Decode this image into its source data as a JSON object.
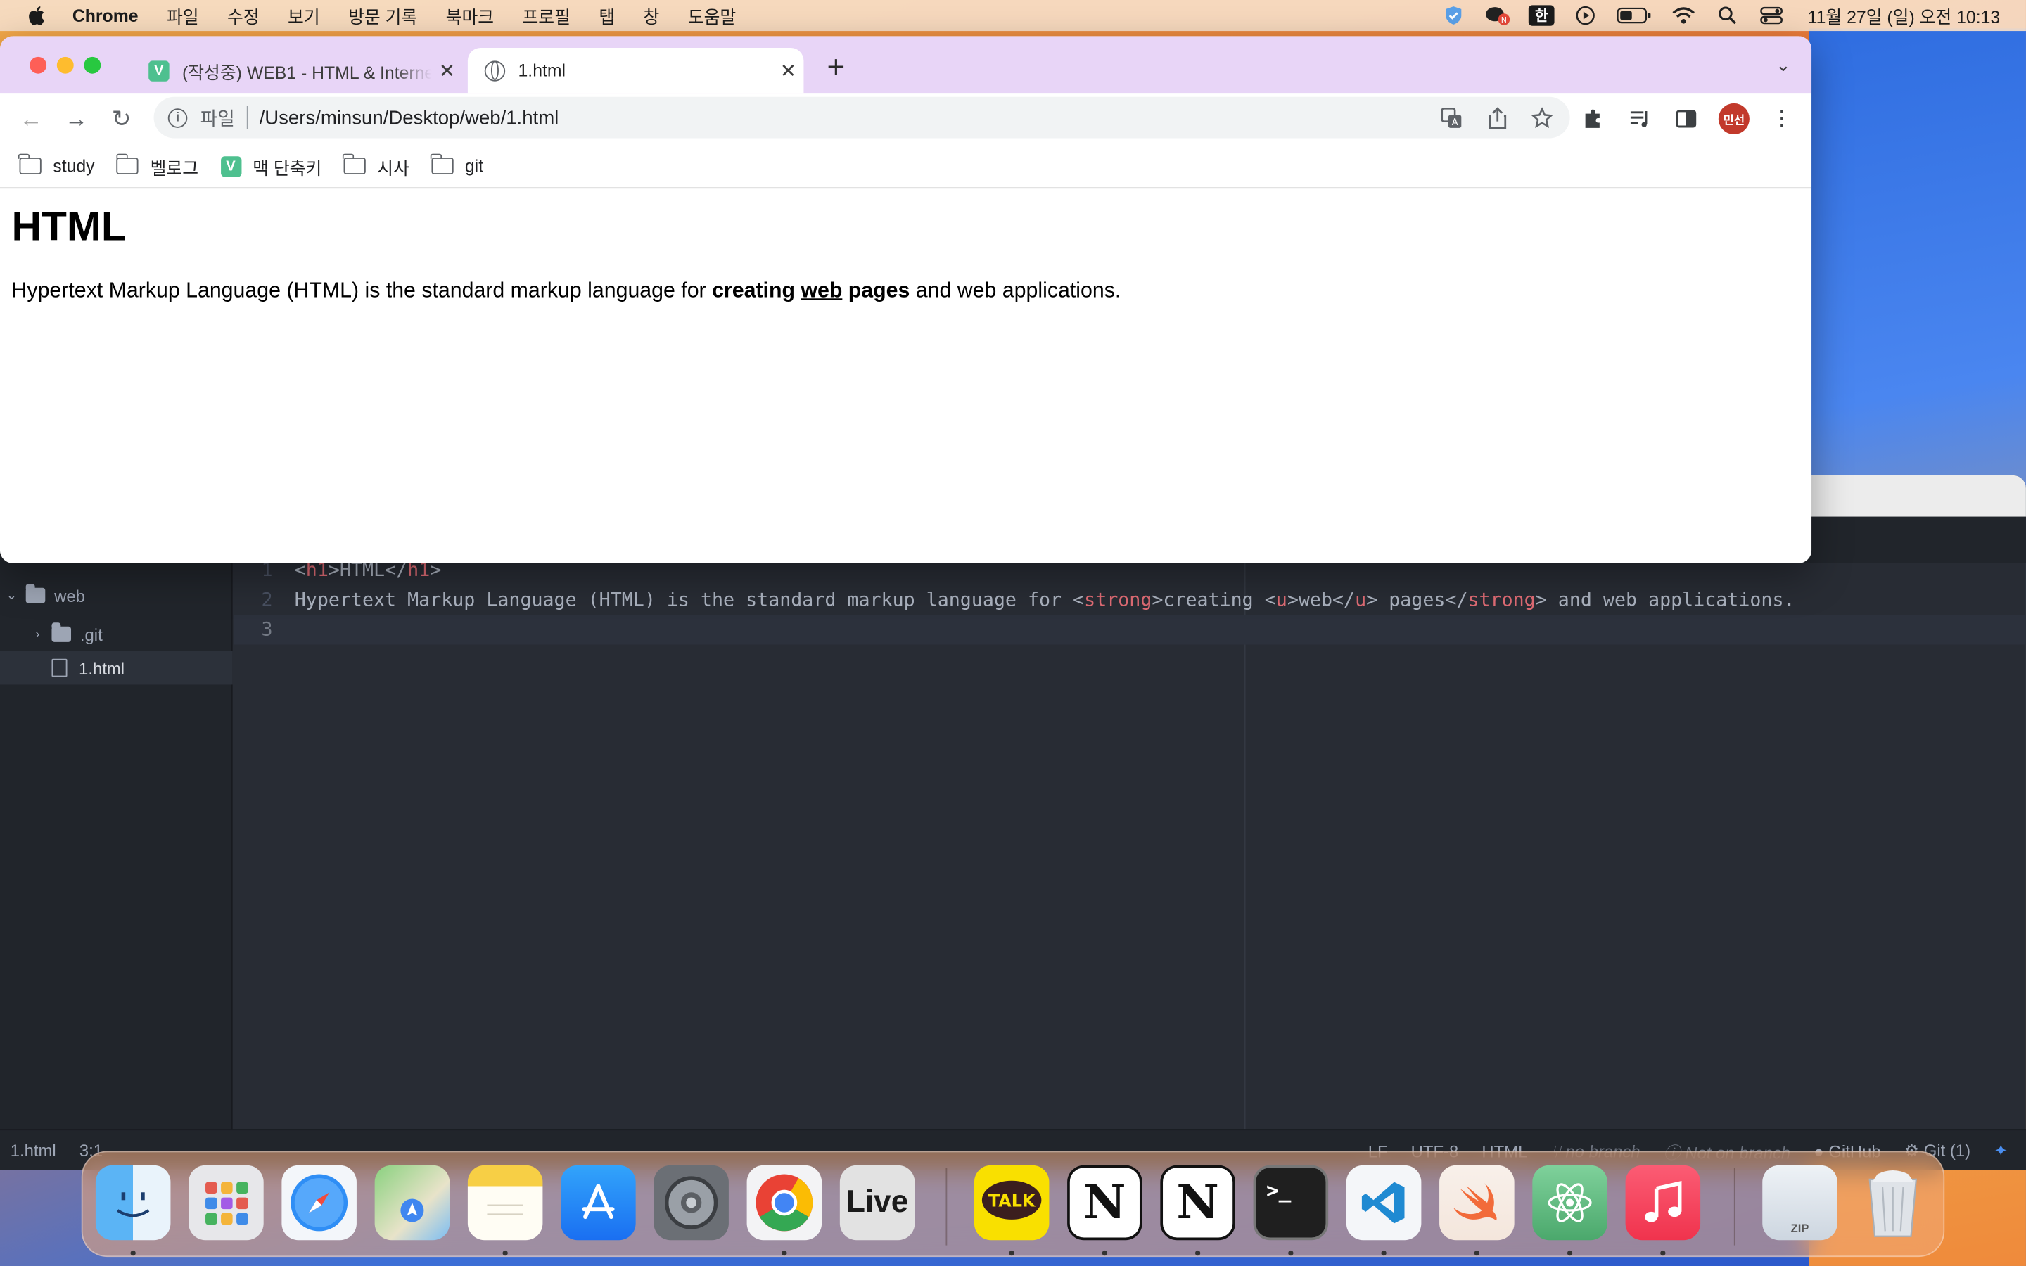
{
  "menubar": {
    "app_name": "Chrome",
    "items": [
      "파일",
      "수정",
      "보기",
      "방문 기록",
      "북마크",
      "프로필",
      "탭",
      "창",
      "도움말"
    ],
    "status_icons": [
      "shield-icon",
      "chat-notification-icon",
      "input-source-icon",
      "play-icon",
      "battery-icon",
      "wifi-icon",
      "spotlight-search-icon",
      "control-center-icon"
    ],
    "input_source": "한",
    "clock": "11월 27일 (일) 오전 10:13"
  },
  "chrome": {
    "tabs": [
      {
        "title": "(작성중) WEB1 - HTML & Internet",
        "favicon": "V",
        "active": false
      },
      {
        "title": "1.html",
        "favicon": "globe-icon",
        "active": true
      }
    ],
    "omnibox": {
      "scheme": "파일",
      "url": "/Users/minsun/Desktop/web/1.html"
    },
    "profile_label": "민선",
    "bookmarks": [
      {
        "label": "study",
        "icon": "folder-icon"
      },
      {
        "label": "벨로그",
        "icon": "folder-icon"
      },
      {
        "label": "맥 단축키",
        "icon": "v-icon"
      },
      {
        "label": "시사",
        "icon": "folder-icon"
      },
      {
        "label": "git",
        "icon": "folder-icon"
      }
    ],
    "page": {
      "heading": "HTML",
      "paragraph_start": "Hypertext Markup Language (HTML) is the standard markup language for ",
      "strong_1": "creating ",
      "underlined": "web",
      "strong_2": " pages",
      "paragraph_end": " and web applications."
    }
  },
  "editor": {
    "tree": [
      {
        "label": "web",
        "type": "folder",
        "expanded": true
      },
      {
        "label": ".git",
        "type": "folder",
        "expanded": false
      },
      {
        "label": "1.html",
        "type": "file",
        "selected": true
      }
    ],
    "line_numbers": [
      "1",
      "2",
      "3"
    ],
    "statusbar": {
      "file": "1.html",
      "cursor": "3:1",
      "line_ending": "LF",
      "encoding": "UTF-8",
      "grammar": "HTML",
      "branch": "no branch",
      "not_on_branch": "Not on branch",
      "github": "GitHub",
      "git": "Git (1)"
    }
  },
  "dock": {
    "apps": [
      "Finder",
      "Launchpad",
      "Safari",
      "Maps",
      "Notes",
      "App Store",
      "System Preferences",
      "Chrome",
      "Live",
      "KakaoTalk",
      "Notion",
      "Notion",
      "Terminal",
      "Visual Studio Code",
      "Swift Playgrounds",
      "Atom",
      "Music",
      "Archive",
      "Trash"
    ],
    "live_label": "Live",
    "talk_label": "TALK",
    "zip_label": "ZIP"
  }
}
